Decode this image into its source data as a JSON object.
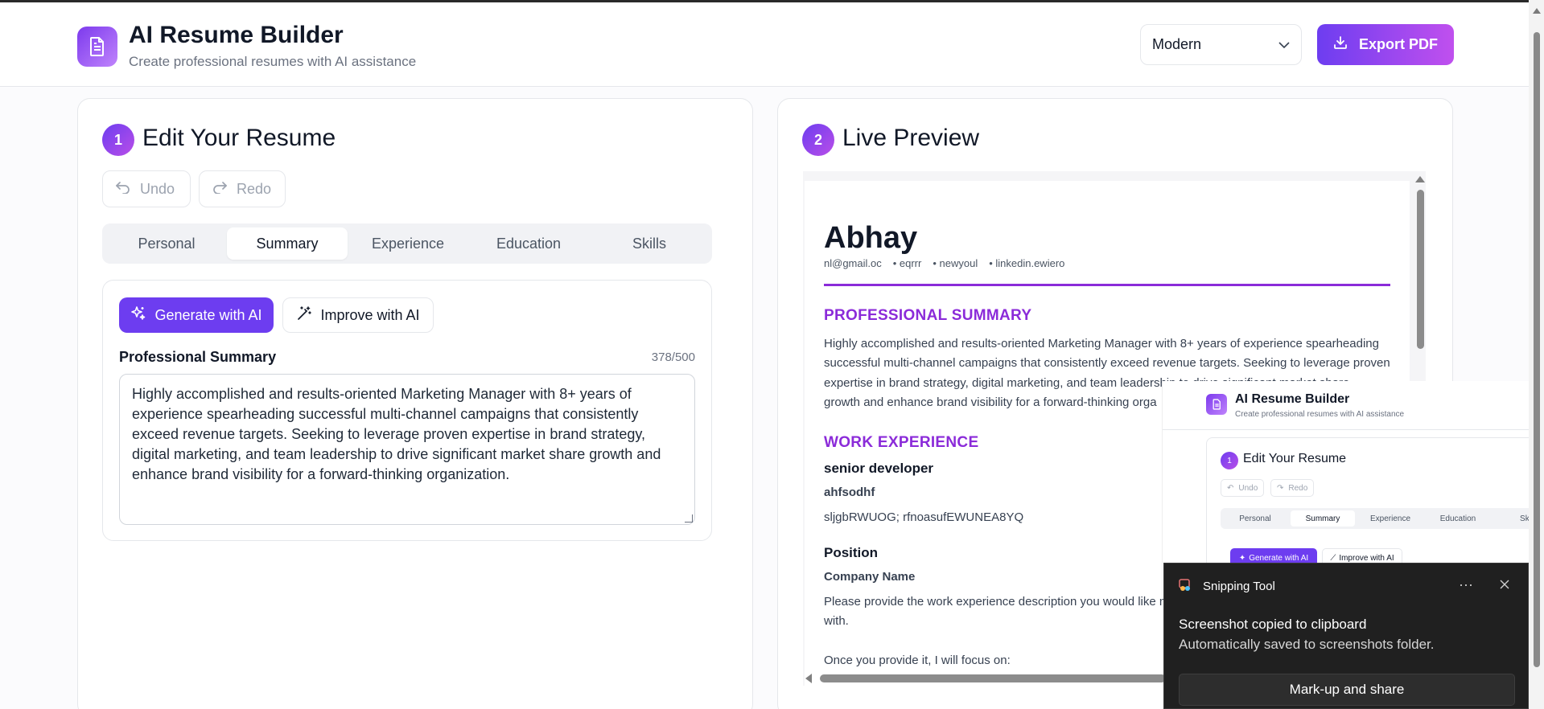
{
  "header": {
    "title": "AI Resume Builder",
    "subtitle": "Create professional resumes with AI assistance",
    "template_value": "Modern",
    "export_label": "Export PDF"
  },
  "editor": {
    "step": "1",
    "title": "Edit Your Resume",
    "undo_label": "Undo",
    "redo_label": "Redo",
    "tabs": [
      {
        "label": "Personal"
      },
      {
        "label": "Summary"
      },
      {
        "label": "Experience"
      },
      {
        "label": "Education"
      },
      {
        "label": "Skills"
      }
    ],
    "active_tab": "Summary",
    "generate_label": "Generate with AI",
    "improve_label": "Improve with AI",
    "field_label": "Professional Summary",
    "char_count": "378/500",
    "summary_text": "Highly accomplished and results-oriented Marketing Manager with 8+ years of experience spearheading successful multi-channel campaigns that consistently exceed revenue targets. Seeking to leverage proven expertise in brand strategy, digital marketing, and team leadership to drive significant market share growth and enhance brand visibility for a forward-thinking organization."
  },
  "preview": {
    "step": "2",
    "title": "Live Preview",
    "resume": {
      "name": "Abhay",
      "contact": [
        "nl@gmail.oc",
        "• eqrrr",
        "• newyoul",
        "• linkedin.ewiero"
      ],
      "summary_heading": "PROFESSIONAL SUMMARY",
      "summary_lines": [
        "Highly accomplished and results-oriented Marketing Manager with 8+ years of experience spearheading",
        "successful multi-channel campaigns that consistently exceed revenue targets. Seeking to leverage proven",
        "expertise in brand strategy, digital marketing, and team leadership to drive significant market share",
        "growth and enhance brand visibility for a forward-thinking orga"
      ],
      "experience_heading": "WORK EXPERIENCE",
      "jobs": [
        {
          "title": "senior developer",
          "company": "ahfsodhf",
          "desc": "sljgbRWUOG; rfnoasufEWUNEA8YQ"
        },
        {
          "title": "Position",
          "company": "Company Name",
          "desc": "Please provide the work experience description you would like m",
          "desc2": "with.",
          "desc3": "Once you provide it, I will focus on:"
        }
      ]
    }
  },
  "snip_thumbnail": {
    "title": "AI Resume Builder",
    "subtitle": "Create professional resumes with AI assistance",
    "step": "1",
    "heading": "Edit Your Resume",
    "undo": "Undo",
    "redo": "Redo",
    "tabs": [
      "Personal",
      "Summary",
      "Experience",
      "Education",
      "Ski"
    ],
    "generate": "Generate with AI",
    "improve": "Improve with AI"
  },
  "toast": {
    "app_name": "Snipping Tool",
    "more": "···",
    "title": "Screenshot copied to clipboard",
    "body": "Automatically saved to screenshots folder.",
    "action": "Mark-up and share"
  },
  "colors": {
    "accent": "#6d3df0",
    "accent_gradient_end": "#c050ee",
    "resume_accent": "#8b2bd9",
    "toast_bg": "#202020"
  },
  "icons": {
    "logo": "document-icon",
    "export": "download-icon",
    "undo": "undo-icon",
    "redo": "redo-icon",
    "generate": "sparkles-icon",
    "improve": "magic-wand-icon",
    "dropdown": "chevron-down-icon",
    "toast_app": "snipping-tool-icon",
    "toast_close": "close-icon"
  }
}
